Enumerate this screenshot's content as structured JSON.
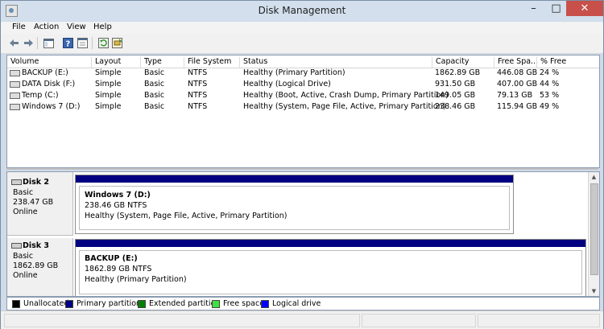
{
  "window": {
    "title": "Disk Management",
    "minimize": "–",
    "maximize": "□",
    "close": "✕"
  },
  "menu": [
    "File",
    "Action",
    "View",
    "Help"
  ],
  "columns": [
    "Volume",
    "Layout",
    "Type",
    "File System",
    "Status",
    "Capacity",
    "Free Spa...",
    "% Free"
  ],
  "volumes": [
    {
      "volume": "BACKUP (E:)",
      "layout": "Simple",
      "type": "Basic",
      "fs": "NTFS",
      "status": "Healthy (Primary Partition)",
      "capacity": "1862.89 GB",
      "free": "446.08 GB",
      "pct": "24 %"
    },
    {
      "volume": "DATA Disk (F:)",
      "layout": "Simple",
      "type": "Basic",
      "fs": "NTFS",
      "status": "Healthy (Logical Drive)",
      "capacity": "931.50 GB",
      "free": "407.00 GB",
      "pct": "44 %"
    },
    {
      "volume": "Temp (C:)",
      "layout": "Simple",
      "type": "Basic",
      "fs": "NTFS",
      "status": "Healthy (Boot, Active, Crash Dump, Primary Partition)",
      "capacity": "149.05 GB",
      "free": "79.13 GB",
      "pct": "53 %"
    },
    {
      "volume": "Windows 7 (D:)",
      "layout": "Simple",
      "type": "Basic",
      "fs": "NTFS",
      "status": "Healthy (System, Page File, Active, Primary Partition)",
      "capacity": "238.46 GB",
      "free": "115.94 GB",
      "pct": "49 %"
    }
  ],
  "disks": [
    {
      "name": "Disk 2",
      "type": "Basic",
      "size": "238.47 GB",
      "state": "Online",
      "partition": {
        "name": "Windows 7  (D:)",
        "size": "238.46 GB NTFS",
        "status": "Healthy (System, Page File, Active, Primary Partition)"
      }
    },
    {
      "name": "Disk 3",
      "type": "Basic",
      "size": "1862.89 GB",
      "state": "Online",
      "partition": {
        "name": "BACKUP  (E:)",
        "size": "1862.89 GB NTFS",
        "status": "Healthy (Primary Partition)"
      }
    }
  ],
  "legend": [
    {
      "label": "Unallocated",
      "color": "#000000"
    },
    {
      "label": "Primary partition",
      "color": "#000080"
    },
    {
      "label": "Extended partition",
      "color": "#008000"
    },
    {
      "label": "Free space",
      "color": "#40e040"
    },
    {
      "label": "Logical drive",
      "color": "#0000ff"
    }
  ],
  "icons": [
    "back-arrow-icon",
    "forward-arrow-icon",
    "show-hide-console-tree-icon",
    "help-icon",
    "properties-icon",
    "refresh-icon",
    "rescan-disks-icon"
  ]
}
